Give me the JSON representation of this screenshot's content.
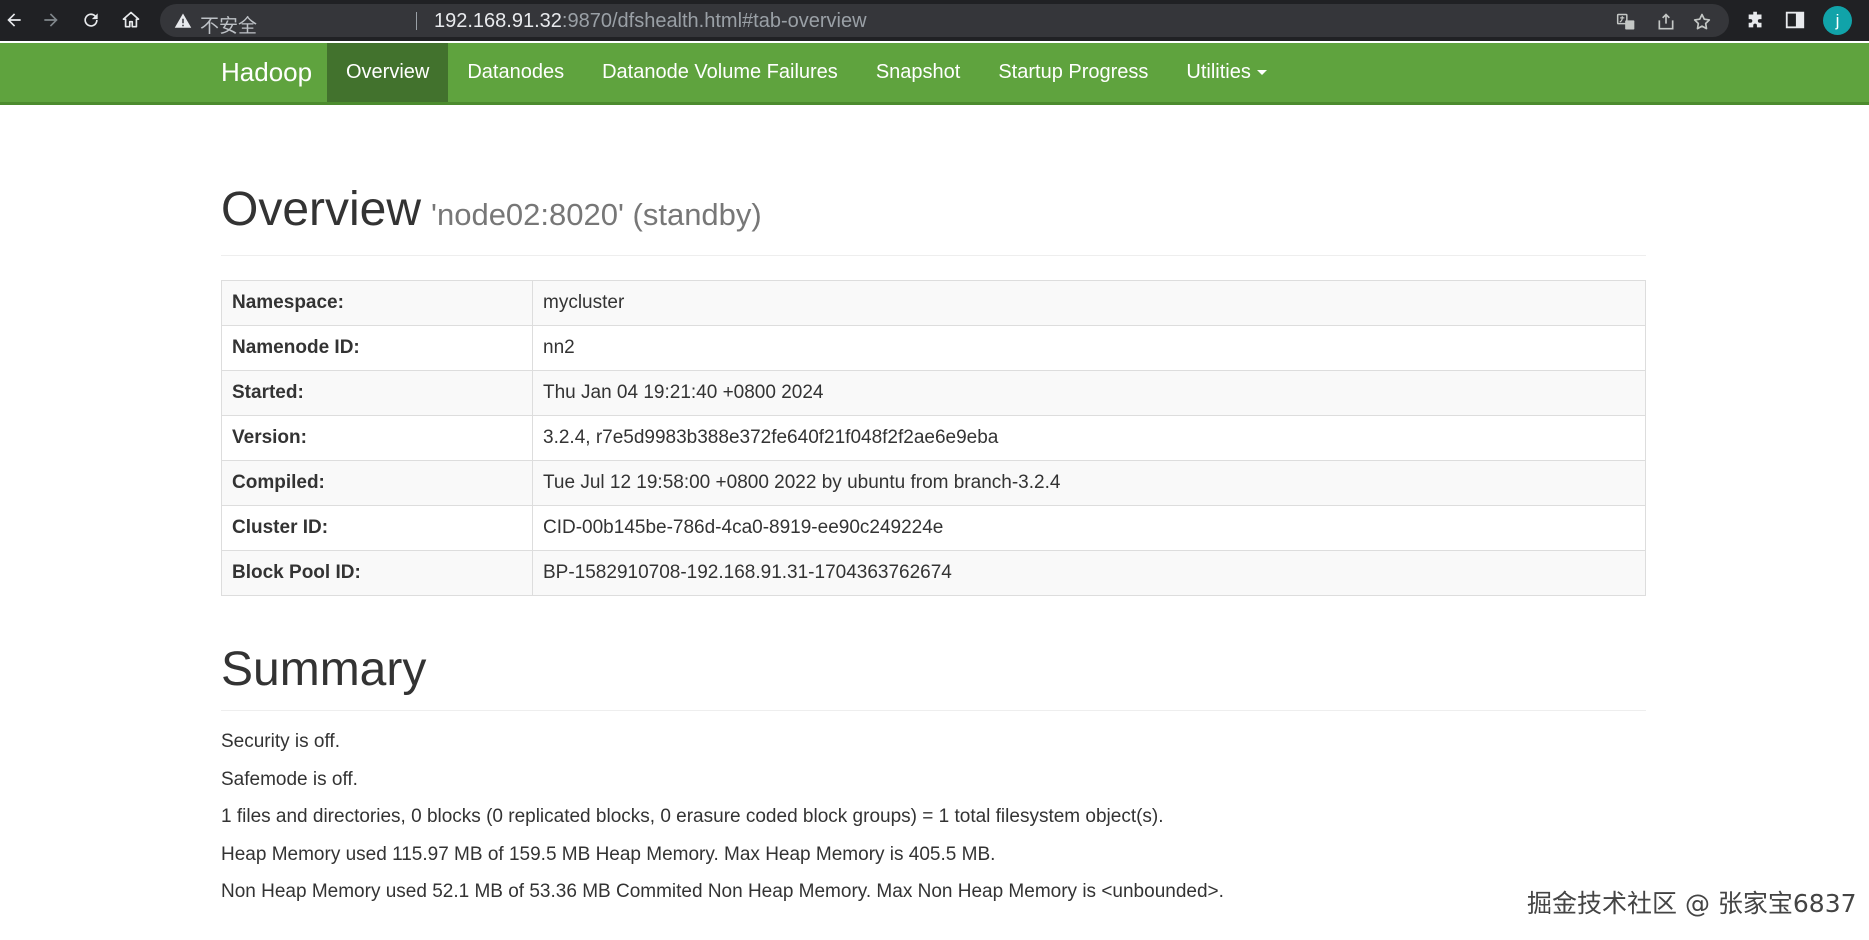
{
  "browser": {
    "insecure_label": "不安全",
    "url_host": "192.168.91.32",
    "url_rest": ":9870/dfshealth.html#tab-overview",
    "avatar_letter": "j"
  },
  "navbar": {
    "brand": "Hadoop",
    "items": [
      {
        "label": "Overview",
        "active": true
      },
      {
        "label": "Datanodes"
      },
      {
        "label": "Datanode Volume Failures"
      },
      {
        "label": "Snapshot"
      },
      {
        "label": "Startup Progress"
      },
      {
        "label": "Utilities"
      }
    ],
    "colors": {
      "bar": "#5fa33e",
      "active": "#42722d"
    }
  },
  "overview": {
    "title": "Overview",
    "subtitle": "'node02:8020' (standby)",
    "rows": [
      {
        "label": "Namespace:",
        "value": "mycluster"
      },
      {
        "label": "Namenode ID:",
        "value": "nn2"
      },
      {
        "label": "Started:",
        "value": "Thu Jan 04 19:21:40 +0800 2024"
      },
      {
        "label": "Version:",
        "value": "3.2.4, r7e5d9983b388e372fe640f21f048f2f2ae6e9eba"
      },
      {
        "label": "Compiled:",
        "value": "Tue Jul 12 19:58:00 +0800 2022 by ubuntu from branch-3.2.4"
      },
      {
        "label": "Cluster ID:",
        "value": "CID-00b145be-786d-4ca0-8919-ee90c249224e"
      },
      {
        "label": "Block Pool ID:",
        "value": "BP-1582910708-192.168.91.31-1704363762674"
      }
    ]
  },
  "summary": {
    "title": "Summary",
    "lines": [
      "Security is off.",
      "Safemode is off.",
      "1 files and directories, 0 blocks (0 replicated blocks, 0 erasure coded block groups) = 1 total filesystem object(s).",
      "Heap Memory used 115.97 MB of 159.5 MB Heap Memory. Max Heap Memory is 405.5 MB.",
      "Non Heap Memory used 52.1 MB of 53.36 MB Commited Non Heap Memory. Max Non Heap Memory is <unbounded>."
    ]
  },
  "watermark": {
    "credit": "掘金技术社区 @ 张家宝6837"
  }
}
